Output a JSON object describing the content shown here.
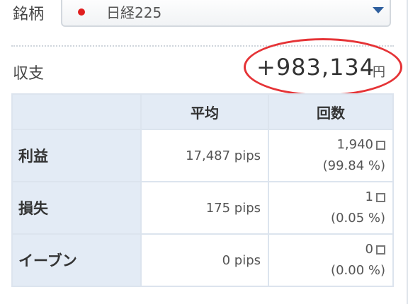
{
  "symbol": {
    "label": "銘柄",
    "value": "日経225"
  },
  "pnl": {
    "label": "収支",
    "value": "+983,134",
    "unit": "円"
  },
  "table": {
    "headers": {
      "average": "平均",
      "count": "回数"
    },
    "rows": [
      {
        "label": "利益",
        "average": "17,487 pips",
        "count": "1,940",
        "percent": "(99.84 %)"
      },
      {
        "label": "損失",
        "average": "175 pips",
        "count": "1",
        "percent": "(0.05 %)"
      },
      {
        "label": "イーブン",
        "average": "0 pips",
        "count": "0",
        "percent": "(0.00 %)"
      }
    ]
  },
  "colors": {
    "accent_circle": "#e53336",
    "header_bg": "#e3ebf5",
    "flag": "#e01e1e"
  }
}
